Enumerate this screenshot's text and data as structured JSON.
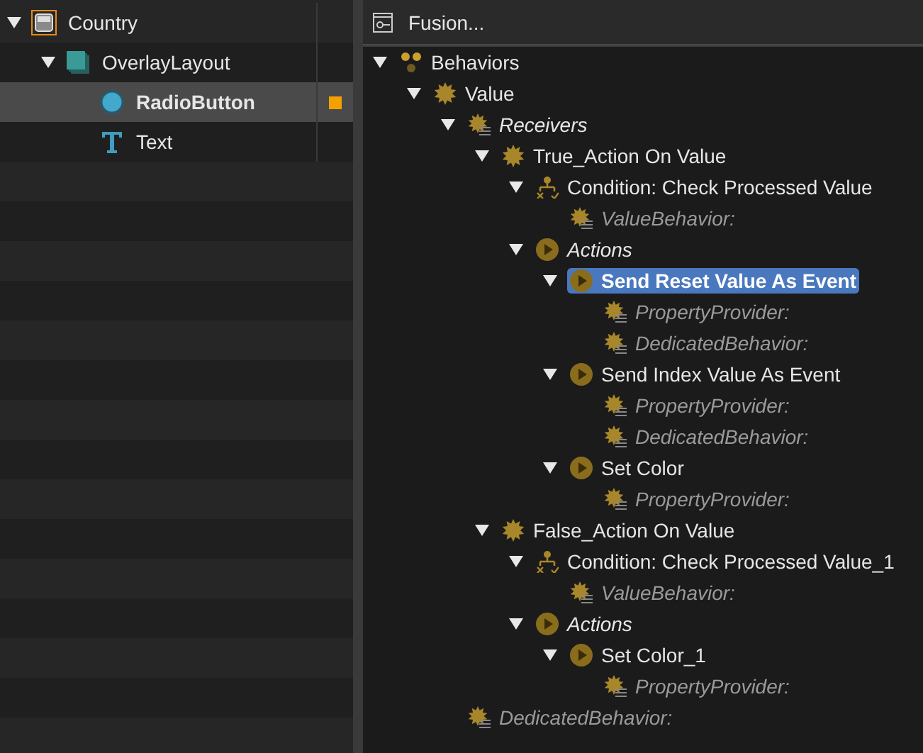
{
  "outline": {
    "items": [
      {
        "label": "Country",
        "kind": "window",
        "selected": false,
        "flagged": false,
        "expanded": true,
        "children": [
          {
            "label": "OverlayLayout",
            "kind": "layout",
            "selected": false,
            "flagged": false,
            "expanded": true,
            "children": [
              {
                "label": "RadioButton",
                "kind": "radio",
                "selected": true,
                "flagged": true
              },
              {
                "label": "Text",
                "kind": "text",
                "selected": false,
                "flagged": false
              }
            ]
          }
        ]
      }
    ]
  },
  "behavior_panel": {
    "title": "Fusion...",
    "tree": [
      {
        "label": "Behaviors",
        "kind": "group",
        "selected": false,
        "expanded": true,
        "children": [
          {
            "label": "Value",
            "kind": "behavior",
            "selected": false,
            "expanded": true,
            "children": [
              {
                "label": "Receivers",
                "kind": "receivers",
                "selected": false,
                "expanded": true,
                "children": [
                  {
                    "label": "True_Action On Value",
                    "kind": "behavior",
                    "selected": false,
                    "expanded": true,
                    "children": [
                      {
                        "label": "Condition: Check Processed Value",
                        "kind": "condition",
                        "selected": false,
                        "expanded": true,
                        "children": [
                          {
                            "label": "ValueBehavior:",
                            "kind": "property",
                            "selected": false
                          }
                        ]
                      },
                      {
                        "label": "Actions",
                        "kind": "actions",
                        "selected": false,
                        "expanded": true,
                        "children": [
                          {
                            "label": "Send Reset Value As Event",
                            "kind": "action",
                            "selected": true,
                            "expanded": true,
                            "children": [
                              {
                                "label": "PropertyProvider:",
                                "kind": "property",
                                "selected": false
                              },
                              {
                                "label": "DedicatedBehavior:",
                                "kind": "property",
                                "selected": false
                              }
                            ]
                          },
                          {
                            "label": "Send Index Value As Event",
                            "kind": "action",
                            "selected": false,
                            "expanded": true,
                            "children": [
                              {
                                "label": "PropertyProvider:",
                                "kind": "property",
                                "selected": false
                              },
                              {
                                "label": "DedicatedBehavior:",
                                "kind": "property",
                                "selected": false
                              }
                            ]
                          },
                          {
                            "label": "Set Color",
                            "kind": "action",
                            "selected": false,
                            "expanded": true,
                            "children": [
                              {
                                "label": "PropertyProvider:",
                                "kind": "property",
                                "selected": false
                              }
                            ]
                          }
                        ]
                      }
                    ]
                  },
                  {
                    "label": "False_Action On Value",
                    "kind": "behavior",
                    "selected": false,
                    "expanded": true,
                    "children": [
                      {
                        "label": "Condition: Check Processed Value_1",
                        "kind": "condition",
                        "selected": false,
                        "expanded": true,
                        "children": [
                          {
                            "label": "ValueBehavior:",
                            "kind": "property",
                            "selected": false
                          }
                        ]
                      },
                      {
                        "label": "Actions",
                        "kind": "actions",
                        "selected": false,
                        "expanded": true,
                        "children": [
                          {
                            "label": "Set Color_1",
                            "kind": "action",
                            "selected": false,
                            "expanded": true,
                            "children": [
                              {
                                "label": "PropertyProvider:",
                                "kind": "property",
                                "selected": false
                              }
                            ]
                          }
                        ]
                      }
                    ]
                  }
                ]
              },
              {
                "label": "DedicatedBehavior:",
                "kind": "property",
                "selected": false
              }
            ]
          }
        ]
      }
    ]
  }
}
